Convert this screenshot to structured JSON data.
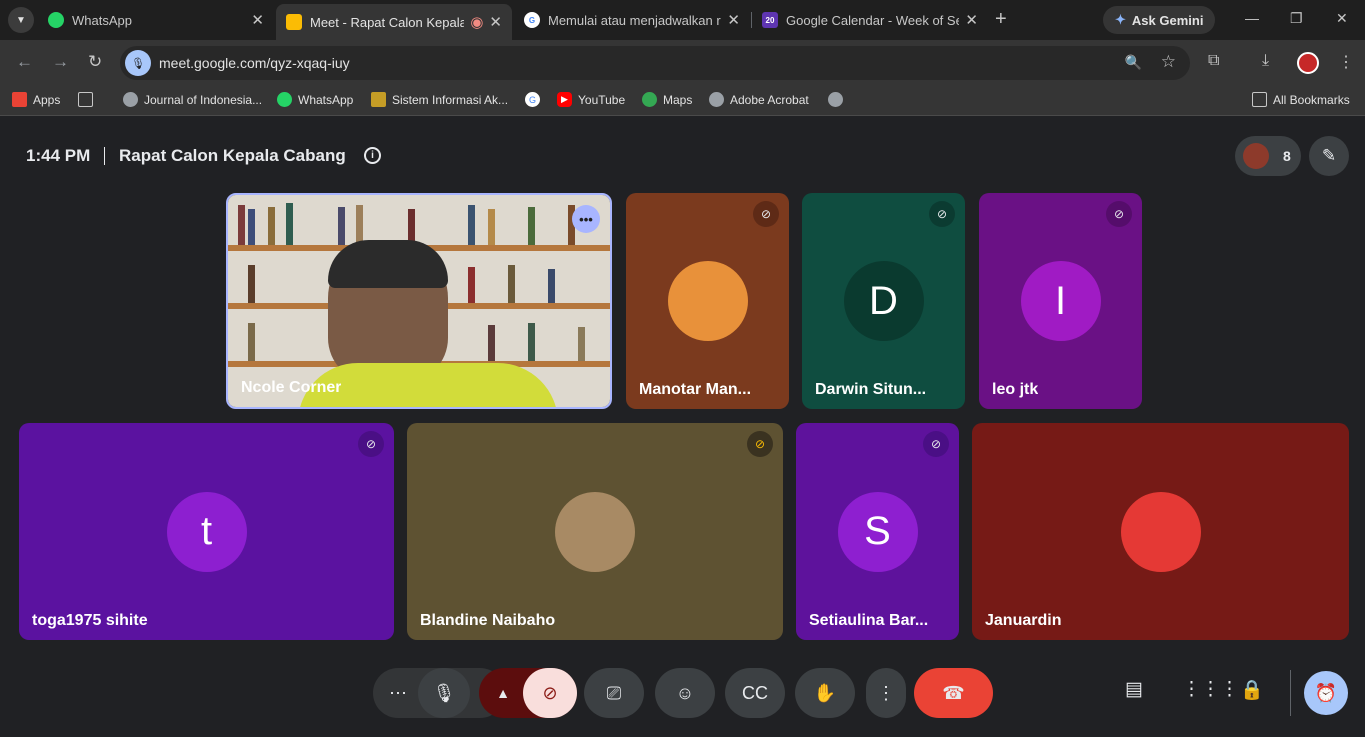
{
  "browser": {
    "tabs": [
      {
        "title": "WhatsApp",
        "active": false
      },
      {
        "title": "Meet - Rapat Calon Kepala",
        "active": true
      },
      {
        "title": "Memulai atau menjadwalkan ra",
        "active": false
      },
      {
        "title": "Google Calendar - Week of Sep",
        "active": false
      }
    ],
    "calendar_favicon_text": "20",
    "gemini_label": "Ask Gemini",
    "url": "meet.google.com/qyz-xqaq-iuy",
    "bookmarks": [
      {
        "label": "Apps",
        "icon": "apps-grid-icon"
      },
      {
        "label": "",
        "icon": "grid-icon"
      },
      {
        "label": "Journal of Indonesia...",
        "icon": "globe-icon"
      },
      {
        "label": "WhatsApp",
        "icon": "whatsapp-icon"
      },
      {
        "label": "Sistem Informasi Ak...",
        "icon": "site-icon"
      },
      {
        "label": "",
        "icon": "google-icon"
      },
      {
        "label": "YouTube",
        "icon": "youtube-icon"
      },
      {
        "label": "Maps",
        "icon": "maps-icon"
      },
      {
        "label": "Adobe Acrobat",
        "icon": "globe-icon"
      },
      {
        "label": "",
        "icon": "globe-icon"
      }
    ],
    "all_bookmarks": "All Bookmarks"
  },
  "meeting": {
    "time": "1:44 PM",
    "title": "Rapat Calon Kepala Cabang",
    "participant_count": "8",
    "tiles": [
      {
        "name": "Ncole Corner",
        "type": "video",
        "muted": false
      },
      {
        "name": "Manotar Man...",
        "type": "photo",
        "muted": true
      },
      {
        "name": "Darwin Situn...",
        "type": "letter",
        "letter": "D",
        "muted": true
      },
      {
        "name": "leo jtk",
        "type": "letter",
        "letter": "I",
        "muted": true
      },
      {
        "name": "toga1975 sihite",
        "type": "letter",
        "letter": "t",
        "muted": true
      },
      {
        "name": "Blandine Naibaho",
        "type": "photo",
        "muted": true
      },
      {
        "name": "Setiaulina Bar...",
        "type": "letter",
        "letter": "S",
        "muted": true
      },
      {
        "name": "Januardin",
        "type": "photo",
        "muted": false
      }
    ]
  },
  "controls": {
    "more_options": "⋯",
    "mic": "microphone-icon",
    "camera": "camera-off-icon",
    "present": "present-screen-icon",
    "reactions": "emoji-icon",
    "captions": "captions-icon",
    "raise_hand": "raise-hand-icon",
    "more": "more-vert-icon",
    "leave": "leave-call-icon",
    "chat": "chat-icon",
    "activities": "activities-icon",
    "host_controls": "host-lock-icon",
    "timer": "timer-icon"
  },
  "colors": {
    "leave_red": "#ea4335",
    "camera_off_bg": "#f9dedc",
    "accent_blue": "#a8c7fa"
  }
}
